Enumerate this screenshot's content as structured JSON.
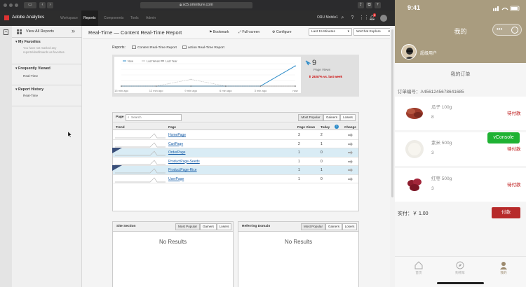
{
  "browser": {
    "url": "sc5.omniture.com",
    "app_name": "Adobe Analytics",
    "nav": [
      "Workspace",
      "Reports",
      "Components",
      "Tools",
      "Admin"
    ],
    "user": "ORU Mobile1",
    "notification_count": "5"
  },
  "sidebar": {
    "view_all": "View All Reports",
    "favorites_title": "My Favorites",
    "favorites_empty": "You have not marked any reports/dashboards as favorites.",
    "frequent_title": "Frequently Viewed",
    "frequent_item": "Real-Time",
    "history_title": "Report History",
    "history_item": "Real-Time"
  },
  "main": {
    "title": "Real-Time — Content Real-Time Report",
    "bookmark": "Bookmark",
    "fullscreen": "Full-screen",
    "configure": "Configure",
    "time_range": "Last 15 Minutes",
    "suite": "WeChat Explore",
    "reports_label": "Reports:",
    "report_tab_1": "Content Real-Time Report",
    "report_tab_2": "action Real-Time Report"
  },
  "chart_data": {
    "type": "line",
    "legend": [
      "Now",
      "Last Week",
      "Last Year"
    ],
    "x": [
      "15 min ago",
      "12 min ago",
      "9 min ago",
      "6 min ago",
      "3 min ago",
      "now"
    ],
    "series": [
      {
        "name": "Now",
        "values": [
          0,
          0,
          0,
          0,
          0,
          9
        ]
      },
      {
        "name": "Last Week",
        "values": [
          0,
          0,
          3,
          0,
          0,
          0
        ]
      },
      {
        "name": "Last Year",
        "values": [
          0,
          0,
          0,
          0,
          0,
          0
        ]
      }
    ],
    "ylim": [
      0,
      10
    ],
    "grid": true
  },
  "stats": {
    "page_views_value": "9",
    "page_views_label": "Page Views",
    "change": "28.57% vs. last week"
  },
  "table": {
    "page_tab": "Page",
    "search_placeholder": "Search",
    "filters": [
      "Most Popular",
      "Gainers",
      "Losers"
    ],
    "columns": [
      "Trend",
      "Page",
      "Page Views",
      "Today",
      "Change"
    ],
    "rows": [
      {
        "page": "HomePage",
        "views": "3",
        "today": "2"
      },
      {
        "page": "CartPage",
        "views": "2",
        "today": "1"
      },
      {
        "page": "OrderPage",
        "views": "1",
        "today": "0"
      },
      {
        "page": "ProductPage-Seeds",
        "views": "1",
        "today": "0"
      },
      {
        "page": "ProductPage-Rice",
        "views": "1",
        "today": "1"
      },
      {
        "page": "UserPage",
        "views": "1",
        "today": "0"
      }
    ]
  },
  "site_section": {
    "title": "Site Section",
    "filters": [
      "Most Popular",
      "Gainers",
      "Losers"
    ],
    "empty": "No Results"
  },
  "referring_domain": {
    "title": "Referring Domain",
    "filters": [
      "Most Popular",
      "Gainers",
      "Losers"
    ],
    "empty": "No Results"
  },
  "phone": {
    "time": "9:41",
    "title": "我的",
    "username": "超级用户",
    "order_title": "我的订单",
    "order_no": "订单编号：A4561245678641685",
    "items": [
      {
        "name": "瓜子 100g",
        "qty": "8",
        "status": "待付款"
      },
      {
        "name": "素米 500g",
        "qty": "3",
        "status": "待付款"
      },
      {
        "name": "红枣 500g",
        "qty": "3",
        "status": "待付款"
      }
    ],
    "total": "实付：￥ 1.00",
    "pay_button": "付款",
    "vconsole": "vConsole",
    "tabs": [
      "首页",
      "购物车",
      "我的"
    ]
  },
  "colors": {
    "accent_red": "#b72a2a",
    "phone_header": "#a99c7f",
    "vconsole_green": "#1fb233",
    "link_blue": "#1a5fa8"
  }
}
